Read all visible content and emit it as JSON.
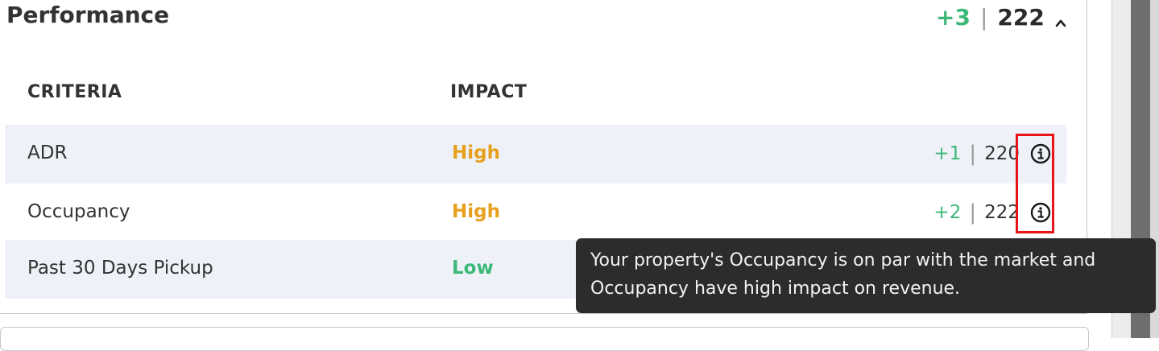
{
  "section": {
    "title": "Performance",
    "delta": "+3",
    "separator": "|",
    "score": "222",
    "collapse_icon": "chevron-up-icon"
  },
  "table": {
    "headers": [
      "CRITERIA",
      "IMPACT"
    ],
    "rows": [
      {
        "criteria": "ADR",
        "impact": "High",
        "impact_level": "high",
        "delta": "+1",
        "separator": "|",
        "score": "220",
        "icon": "info-icon"
      },
      {
        "criteria": "Occupancy",
        "impact": "High",
        "impact_level": "high",
        "delta": "+2",
        "separator": "|",
        "score": "222",
        "icon": "info-icon"
      },
      {
        "criteria": "Past 30 Days Pickup",
        "impact": "Low",
        "impact_level": "low"
      }
    ]
  },
  "tooltip": {
    "line1": "Your property's Occupancy is on par with the market and",
    "line2": "Occupancy have high impact on revenue."
  },
  "colors": {
    "positive": "#3cb878",
    "impact_high": "#e6a01e",
    "impact_low": "#3cb878",
    "row_alt": "#eef2f8",
    "tooltip_bg": "#2c2c2c",
    "highlight": "#e8141a"
  }
}
